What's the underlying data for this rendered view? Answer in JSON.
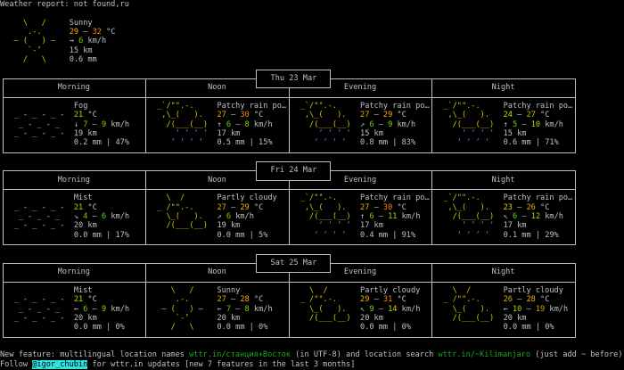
{
  "header": "Weather report: not found,ru",
  "units": {
    "temp": "°C",
    "wind": "km/h",
    "range_sep": " – ",
    "precip_sep": " | "
  },
  "current": {
    "icon": "sunny",
    "condition": "Sunny",
    "temp": [
      29,
      32
    ],
    "wind_dir": "→",
    "wind": [
      6
    ],
    "visibility": "15 km",
    "precip": "0.6 mm"
  },
  "periods": [
    "Morning",
    "Noon",
    "Evening",
    "Night"
  ],
  "days": [
    {
      "date": "Thu 23 Mar",
      "slots": [
        {
          "icon": "fog",
          "condition": "Fog",
          "temp": [
            21
          ],
          "wind_dir": "↓",
          "wind": [
            7,
            9
          ],
          "visibility": "19 km",
          "precip": "0.2 mm",
          "chance": "47%"
        },
        {
          "icon": "rain",
          "condition": "Patchy rain po…",
          "temp": [
            27,
            30
          ],
          "wind_dir": "↑",
          "wind": [
            6,
            8
          ],
          "visibility": "17 km",
          "precip": "0.5 mm",
          "chance": "15%"
        },
        {
          "icon": "rain",
          "condition": "Patchy rain po…",
          "temp": [
            27,
            29
          ],
          "wind_dir": "↗",
          "wind": [
            6,
            9
          ],
          "visibility": "15 km",
          "precip": "0.8 mm",
          "chance": "83%"
        },
        {
          "icon": "rain",
          "condition": "Patchy rain po…",
          "temp": [
            24,
            27
          ],
          "wind_dir": "↑",
          "wind": [
            5,
            10
          ],
          "visibility": "15 km",
          "precip": "0.6 mm",
          "chance": "71%"
        }
      ]
    },
    {
      "date": "Fri 24 Mar",
      "slots": [
        {
          "icon": "fog",
          "condition": "Mist",
          "temp": [
            21
          ],
          "wind_dir": "↘",
          "wind": [
            4,
            6
          ],
          "visibility": "20 km",
          "precip": "0.0 mm",
          "chance": "17%"
        },
        {
          "icon": "partly",
          "condition": "Partly cloudy",
          "temp": [
            27,
            29
          ],
          "wind_dir": "↗",
          "wind": [
            6
          ],
          "visibility": "19 km",
          "precip": "0.0 mm",
          "chance": "5%"
        },
        {
          "icon": "rain",
          "condition": "Patchy rain po…",
          "temp": [
            27,
            30
          ],
          "wind_dir": "↑",
          "wind": [
            6,
            11
          ],
          "visibility": "17 km",
          "precip": "0.4 mm",
          "chance": "91%"
        },
        {
          "icon": "rain",
          "condition": "Patchy rain po…",
          "temp": [
            23,
            26
          ],
          "wind_dir": "↖",
          "wind": [
            6,
            12
          ],
          "visibility": "17 km",
          "precip": "0.1 mm",
          "chance": "29%"
        }
      ]
    },
    {
      "date": "Sat 25 Mar",
      "slots": [
        {
          "icon": "fog",
          "condition": "Mist",
          "temp": [
            21
          ],
          "wind_dir": "←",
          "wind": [
            6,
            9
          ],
          "visibility": "20 km",
          "precip": "0.0 mm",
          "chance": "0%"
        },
        {
          "icon": "sunny",
          "condition": "Sunny",
          "temp": [
            27,
            28
          ],
          "wind_dir": "←",
          "wind": [
            7,
            8
          ],
          "visibility": "20 km",
          "precip": "0.0 mm",
          "chance": "0%"
        },
        {
          "icon": "partly",
          "condition": "Partly cloudy",
          "temp": [
            29,
            31
          ],
          "wind_dir": "↖",
          "wind": [
            9,
            14
          ],
          "visibility": "20 km",
          "precip": "0.0 mm",
          "chance": "0%"
        },
        {
          "icon": "partly",
          "condition": "Partly cloudy",
          "temp": [
            26,
            28
          ],
          "wind_dir": "←",
          "wind": [
            10,
            19
          ],
          "visibility": "20 km",
          "precip": "0.0 mm",
          "chance": "0%"
        }
      ]
    }
  ],
  "icons": {
    "sunny": [
      "    \\   /    ",
      "     .-.     ",
      "  ― (   ) ―  ",
      "     `-’     ",
      "    /   \\    "
    ],
    "fog": [
      "             ",
      " _ - _ - _ - ",
      "  _ - _ - _  ",
      " _ - _ - _ - ",
      "             "
    ],
    "rain": [
      " _`/\"\".-.    ",
      "  ,\\_(   ).  ",
      "   /(___(__) ",
      "     ‘ ‘ ‘ ‘ ",
      "    ‘ ‘ ‘ ‘  "
    ],
    "partly": [
      "   \\  /      ",
      " _ /\"\".-.    ",
      "   \\_(   ).  ",
      "   /(___(__) ",
      "             "
    ]
  },
  "colors": {
    "temp": {
      "21": "#afd700",
      "23": "#d7d700",
      "24": "#d7d700",
      "26": "#d7af00",
      "27": "#d7af00",
      "28": "#ffaf00",
      "29": "#ffaf00",
      "30": "#ff8700",
      "31": "#ff8700",
      "32": "#ff8700"
    },
    "wind": {
      "4": "#5fd700",
      "5": "#5fd700",
      "6": "#5fd700",
      "7": "#5fd700",
      "8": "#87d700",
      "9": "#87d700",
      "10": "#afd700",
      "11": "#afd700",
      "12": "#afd700",
      "14": "#d7d700",
      "19": "#d7af00"
    }
  },
  "footer": {
    "line1_a": "New feature: multilingual location names ",
    "link1": "wttr.in/станция+Восток",
    "line1_b": " (in UTF-8) and location search ",
    "link2": "wttr.in/~Kilimanjaro",
    "line1_c": " (just add ~ before)",
    "line2_a": "Follow ",
    "handle": "@igor_chubin",
    "line2_b": " for wttr.in updates [new 7 features in the last 3 months]"
  }
}
